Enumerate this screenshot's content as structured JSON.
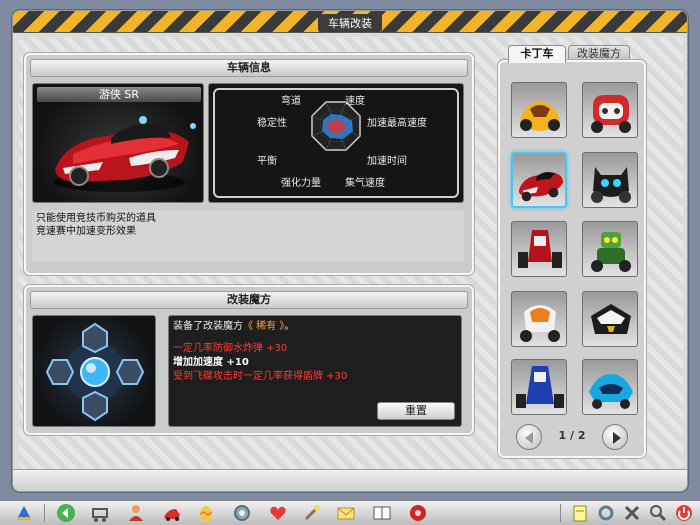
{
  "window": {
    "title": "车辆改装"
  },
  "vehicle_panel": {
    "header": "车辆信息",
    "car_name": "游侠 SR",
    "stats": {
      "labels": [
        "弯道",
        "速度",
        "稳定性",
        "加速最高速度",
        "平衡",
        "加速时间",
        "强化力量",
        "集气速度"
      ]
    },
    "description_lines": [
      "只能使用竞技币购买的道具",
      "竞速赛中加速变形效果"
    ]
  },
  "mod_panel": {
    "header": "改装魔方",
    "equipped_prefix": "装备了改装魔方",
    "equipped_name": "《 稀有 》",
    "equipped_suffix": "。",
    "effects": [
      {
        "text": "一定几率防御水炸弹 +30",
        "color": "#ff3b30"
      },
      {
        "text": "增加加速度 +10",
        "color": "#ffffff"
      },
      {
        "text": "受到飞碟攻击时一定几率获得盾牌 +30",
        "color": "#ff3b30"
      }
    ],
    "reset_label": "重置"
  },
  "list_panel": {
    "tabs": [
      {
        "label": "卡丁车",
        "active": true
      },
      {
        "label": "改装魔方",
        "active": false
      }
    ],
    "pager_text": "1 / 2",
    "selected_index": 2
  },
  "colors": {
    "accent_selection": "#48c6ee",
    "title_stripe": "#f2b52a",
    "stat_fill": "#2f7fd6"
  }
}
